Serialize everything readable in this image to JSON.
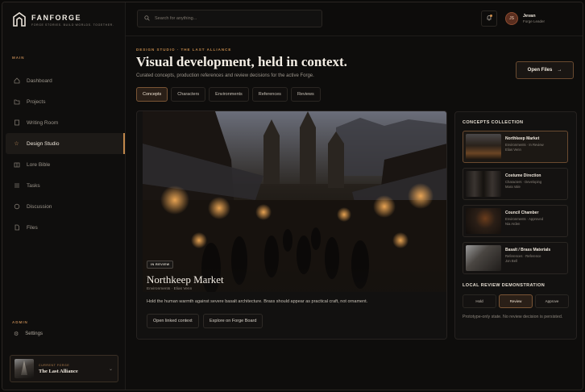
{
  "brand": {
    "name": "FANFORGE",
    "tagline": "FORGE STORIES. BUILD WORLDS. TOGETHER."
  },
  "sidebar": {
    "main_label": "MAIN",
    "items": [
      {
        "label": "Dashboard",
        "icon": "home-icon"
      },
      {
        "label": "Projects",
        "icon": "folder-icon"
      },
      {
        "label": "Writing Room",
        "icon": "document-icon"
      },
      {
        "label": "Design Studio",
        "icon": "star-icon",
        "active": true
      },
      {
        "label": "Lore Bible",
        "icon": "book-icon"
      },
      {
        "label": "Tasks",
        "icon": "checklist-icon"
      },
      {
        "label": "Discussion",
        "icon": "chat-icon"
      },
      {
        "label": "Files",
        "icon": "file-icon"
      }
    ],
    "admin_label": "ADMIN",
    "settings_label": "Settings",
    "current_forge_label": "CURRENT FORGE",
    "current_forge_name": "The Last Alliance"
  },
  "topbar": {
    "search_placeholder": "Search for anything...",
    "user_initials": "JS",
    "user_name": "Jevan",
    "user_role": "Forge Leader"
  },
  "header": {
    "eyebrow": "DESIGN STUDIO · THE LAST ALLIANCE",
    "title": "Visual development, held in context.",
    "subtitle": "Curated concepts, production references and review decisions for the active Forge.",
    "open_files": "Open Files"
  },
  "tabs": [
    "Concepts",
    "Characters",
    "Environments",
    "References",
    "Reviews"
  ],
  "hero": {
    "badge": "IN REVIEW",
    "title": "Northkeep Market",
    "meta": "Environments · Elias Venn",
    "description": "Hold the human warmth against severe basalt architecture. Brass should appear as practical craft, not ornament.",
    "btn_open": "Open linked context",
    "btn_explore": "Explore on Forge Board"
  },
  "panel": {
    "collection_title": "CONCEPTS COLLECTION",
    "concepts": [
      {
        "name": "Northkeep Market",
        "meta1": "Environments · In Review",
        "meta2": "Elias Venn"
      },
      {
        "name": "Costume Direction",
        "meta1": "Characters · Developing",
        "meta2": "Mara Vale"
      },
      {
        "name": "Council Chamber",
        "meta1": "Environments · Approved",
        "meta2": "Nia Arden"
      },
      {
        "name": "Basalt / Brass Materials",
        "meta1": "References · Reference",
        "meta2": "Jon Bell"
      }
    ],
    "review_title": "LOCAL REVIEW DEMONSTRATION",
    "review_buttons": [
      "Hold",
      "Review",
      "Approve"
    ],
    "review_note": "Prototype-only state. No review decision is persisted."
  },
  "colors": {
    "accent": "#c0874a",
    "bg": "#0e0d0c"
  }
}
